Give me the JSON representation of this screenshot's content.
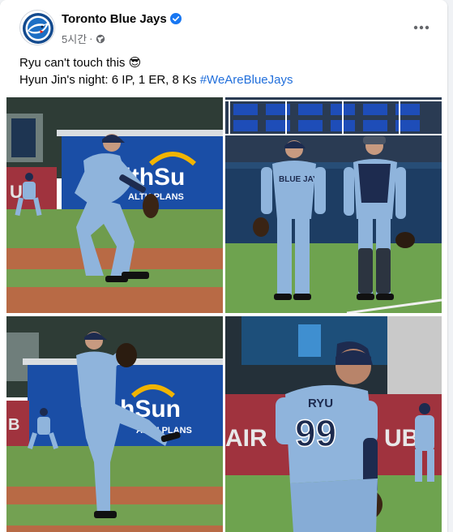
{
  "post": {
    "page_name": "Toronto Blue Jays",
    "timestamp": "5시간",
    "separator": "·",
    "privacy_icon": "globe-icon",
    "text_line_1": "Ryu can't touch this",
    "emoji": "😎",
    "text_line_2": "Hyun Jin's night: 6 IP, 1 ER, 8 Ks",
    "hashtag": "#WeAreBlueJays"
  },
  "photos": [
    {
      "id": "photo-1",
      "sign_text": "ealthSu",
      "sign_sub": "ALTH PLANS",
      "side_text": "UB"
    },
    {
      "id": "photo-2",
      "jersey_text": "BLUE JAYS"
    },
    {
      "id": "photo-3",
      "sign_text": "hSun",
      "sign_sub": "ALTH PLANS",
      "side_text": "B"
    },
    {
      "id": "photo-4",
      "jersey_name": "RYU",
      "jersey_number": "99",
      "wall_text": "AIR",
      "wall_text_2": "UB"
    }
  ],
  "colors": {
    "powder_blue": "#8fb4dc",
    "navy": "#1d2b4f",
    "hashtag": "#216fdb",
    "verified": "#1877f2"
  }
}
